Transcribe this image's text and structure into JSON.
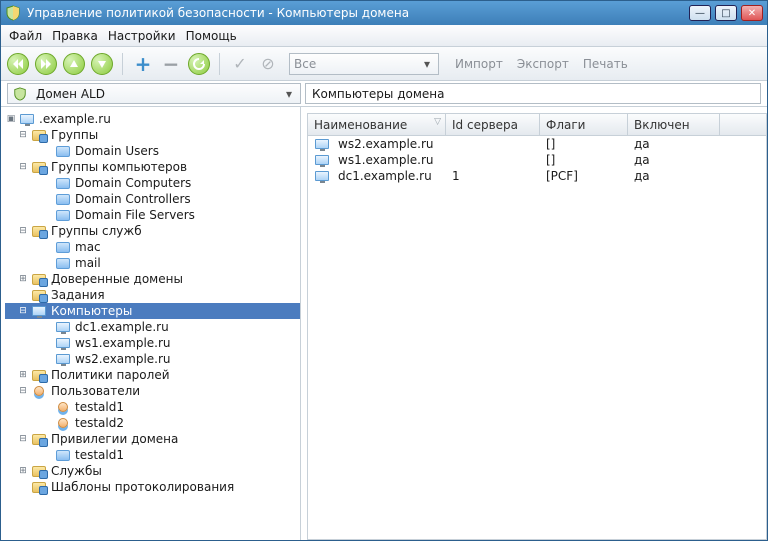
{
  "window": {
    "title": "Управление политикой безопасности - Компьютеры домена"
  },
  "menu": {
    "file": "Файл",
    "edit": "Правка",
    "settings": "Настройки",
    "help": "Помощь"
  },
  "toolbar": {
    "filter_combo": "Все",
    "import": "Импорт",
    "export": "Экспорт",
    "print": "Печать"
  },
  "domain_combo": "Домен ALD",
  "breadcrumb": "Компьютеры домена",
  "tree": {
    "root": ".example.ru",
    "groups": "Группы",
    "domain_users": "Domain Users",
    "comp_groups": "Группы компьютеров",
    "domain_computers": "Domain Computers",
    "domain_controllers": "Domain Controllers",
    "domain_file_servers": "Domain File Servers",
    "svc_groups": "Группы служб",
    "mac": "mac",
    "mail": "mail",
    "trusted_domains": "Доверенные домены",
    "tasks": "Задания",
    "computers": "Компьютеры",
    "dc1": "dc1.example.ru",
    "ws1": "ws1.example.ru",
    "ws2": "ws2.example.ru",
    "pwd_policies": "Политики паролей",
    "users": "Пользователи",
    "testald1": "testald1",
    "testald2": "testald2",
    "domain_privs": "Привилегии домена",
    "priv_testald1": "testald1",
    "services": "Службы",
    "audit_templates": "Шаблоны протоколирования"
  },
  "grid": {
    "columns": {
      "name": "Наименование",
      "server_id": "Id сервера",
      "flags": "Флаги",
      "enabled": "Включен"
    },
    "rows": [
      {
        "name": "ws2.example.ru",
        "server_id": "",
        "flags": "[]",
        "enabled": "да"
      },
      {
        "name": "ws1.example.ru",
        "server_id": "",
        "flags": "[]",
        "enabled": "да"
      },
      {
        "name": "dc1.example.ru",
        "server_id": "1",
        "flags": "[PCF]",
        "enabled": "да"
      }
    ]
  }
}
